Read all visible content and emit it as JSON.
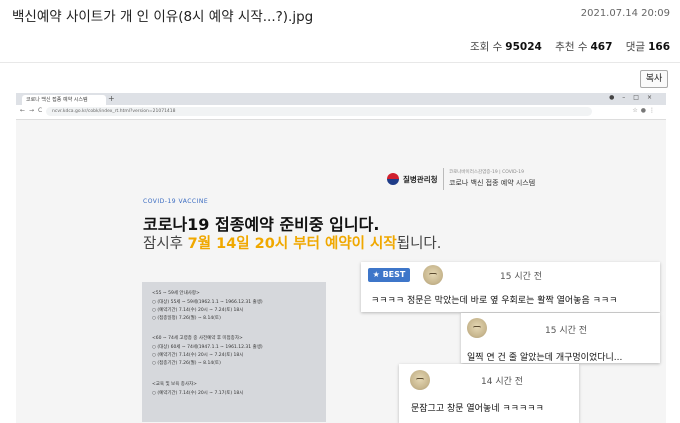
{
  "post": {
    "title": "백신예약 사이트가 개     인 이유(8시 예약 시작...?).jpg",
    "date": "2021.07.14 20:09",
    "views_label": "조회 수",
    "views": "95024",
    "likes_label": "추천 수",
    "likes": "467",
    "comments_label": "댓글",
    "comments": "166",
    "copy_button": "복사"
  },
  "browser": {
    "tab_title": "코로나 백신 접종 예약 시스템",
    "url": "ncvr.kdca.go.kr/cobk/index_rt.html?version=21071418"
  },
  "webpage": {
    "org_name": "질병관리청",
    "org_sub": "코로나바이러스감염증-19 | COVID-19",
    "system_name": "코로나 백신 접종 예약 시스템",
    "covid_label": "COVID-19 VACCINE",
    "headline": "코로나19 접종예약 준비중 입니다.",
    "sub_pre": "잠시후 ",
    "sub_highlight": "7월 14일 20시 부터 예약이 시작",
    "sub_post": "됩니다.",
    "info_lines": [
      "<55 ~ 59세 안내사항>",
      "○ (대상) 55세 ~ 59세(1962.1.1 ~ 1966.12.31 출생)",
      "○ (예약기간) 7.14(수) 20시 ~ 7.24(토) 18시",
      "○ (접종일정) 7.26(월) ~ 8.14(토)",
      "",
      "<60 ~ 74세 고령층 중 사전예약 후 미접종자>",
      "○ (대상) 60세 ~ 74세(1947.1.1 ~ 1961.12.31 출생)",
      "○ (예약기간) 7.14(수) 20시 ~ 7.24(토) 18시",
      "○ (접종기간) 7.26(월) ~ 8.14(토)",
      "",
      "<교육 및 보육 종사자>",
      "○ (예약기간) 7.14(수) 20시 ~ 7.17(토) 18시"
    ]
  },
  "comments": [
    {
      "badge": "★ BEST",
      "time": "15 시간 전",
      "text": "ㅋㅋㅋㅋ 정문은 막았는데 바로 옆 우회로는 활짝 열어놓음 ㅋㅋㅋ"
    },
    {
      "time": "15 시간 전",
      "text": "일찍 연 건 줄 알았는데 개구멍이었다니..."
    },
    {
      "time": "14 시간 전",
      "text": "문잠그고 창문 열어놓네 ㅋㅋㅋㅋㅋ"
    }
  ]
}
